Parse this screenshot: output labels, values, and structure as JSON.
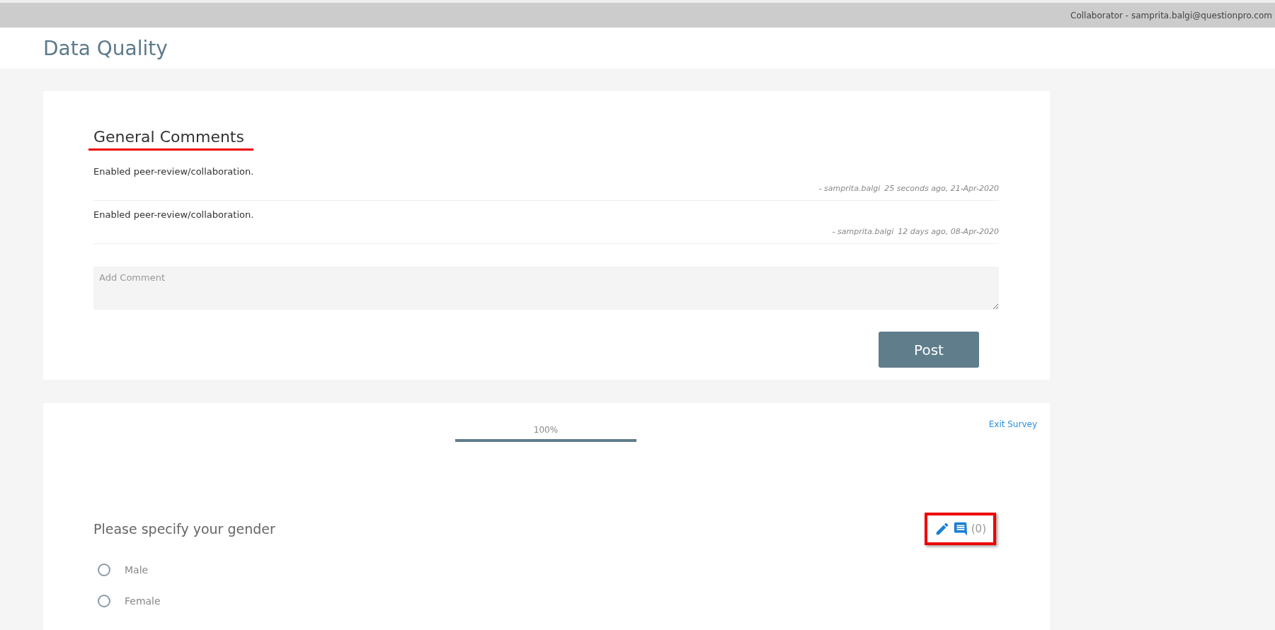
{
  "top_bar": {
    "user": "Collaborator - samprita.balgi@questionpro.com"
  },
  "page": {
    "title": "Data Quality"
  },
  "general_comments": {
    "title": "General Comments",
    "comments": [
      {
        "text": "Enabled peer-review/collaboration.",
        "author": "- samprita.balgi",
        "time": "25 seconds ago, 21-Apr-2020"
      },
      {
        "text": "Enabled peer-review/collaboration.",
        "author": "- samprita.balgi",
        "time": "12 days ago, 08-Apr-2020"
      }
    ],
    "comment_field": {
      "placeholder": "Add Comment"
    },
    "post_button": "Post"
  },
  "survey": {
    "progress": {
      "label": "100%",
      "level": 1
    },
    "exit_link": "Exit Survey",
    "question": {
      "text": "Please specify your gender",
      "comment_count": "(0)",
      "options": [
        {
          "label": "Male",
          "selected": false
        },
        {
          "label": "Female",
          "selected": false
        }
      ]
    }
  }
}
